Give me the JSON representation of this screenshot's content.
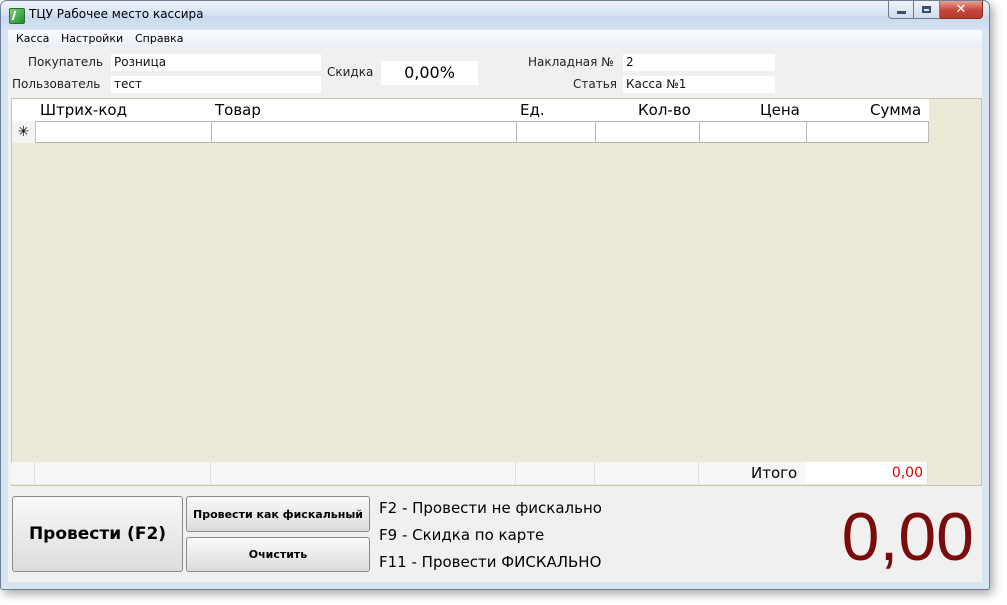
{
  "window": {
    "title": "ТЦУ Рабочее место кассира"
  },
  "menu": [
    "Касса",
    "Настройки",
    "Справка"
  ],
  "form": {
    "buyer_label": "Покупатель",
    "buyer_value": "Розница",
    "user_label": "Пользователь",
    "user_value": "тест",
    "discount_label": "Скидка",
    "discount_value": "0,00%",
    "invoice_label": "Накладная №",
    "invoice_value": "2",
    "article_label": "Статья",
    "article_value": "Касса №1"
  },
  "grid": {
    "columns": [
      "Штрих-код",
      "Товар",
      "Ед.",
      "Кол-во",
      "Цена",
      "Сумма"
    ],
    "new_row_marker": "✳",
    "total_label": "Итого",
    "total_value": "0,00"
  },
  "buttons": {
    "post": "Провести (F2)",
    "post_fiscal": "Провести как фискальный",
    "clear": "Очистить"
  },
  "hints": [
    "F2 - Провести не фискально",
    "F9 - Скидка по карте",
    "F11 - Провести ФИСКАЛЬНО"
  ],
  "big_total": "0,00",
  "colors": {
    "total_value": "#e00000",
    "big_total": "#7a0c0c",
    "grid_background": "#ece9d8"
  }
}
